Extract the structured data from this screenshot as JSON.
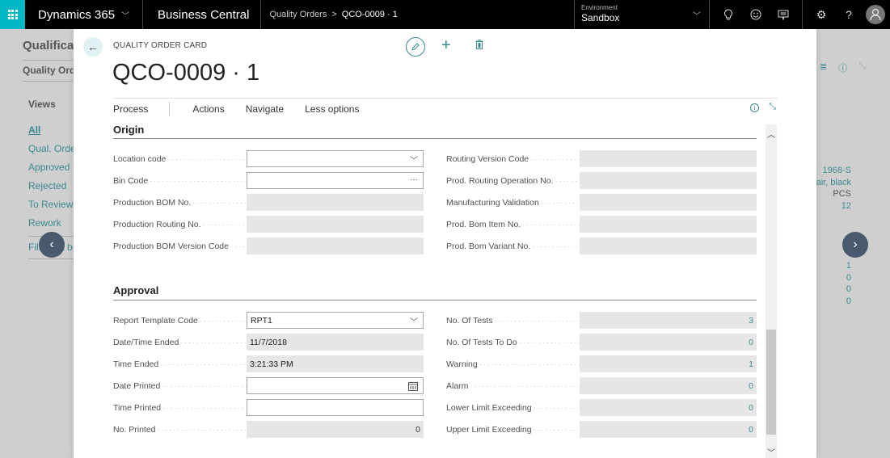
{
  "topbar": {
    "product": "Dynamics 365",
    "app": "Business Central",
    "breadcrumb_parent": "Quality Orders",
    "breadcrumb_sep": ">",
    "breadcrumb_current": "QCO-0009 · 1",
    "environment_label": "Environment",
    "environment_value": "Sandbox",
    "icons": [
      "lightbulb-icon",
      "smiley-icon",
      "feedback-icon",
      "gear-icon",
      "help-icon",
      "user-icon"
    ]
  },
  "background_page": {
    "title": "Qualificat",
    "subtitle": "Quality Orde",
    "views_label": "Views",
    "views": [
      "All",
      "Qual. Orde",
      "Approved",
      "Rejected",
      "To Review",
      "Rework",
      "Filter list b"
    ],
    "right_values": [
      "1968-S",
      "hair, black",
      "PCS",
      "12"
    ],
    "right_values_2": [
      "1",
      "0",
      "0",
      "0"
    ]
  },
  "card": {
    "label": "QUALITY ORDER CARD",
    "title": "QCO-0009 · 1",
    "actions": [
      "Process",
      "Actions",
      "Navigate",
      "Less options"
    ]
  },
  "origin": {
    "title": "Origin",
    "left": [
      {
        "label": "Location code",
        "value": "",
        "type": "dropdown"
      },
      {
        "label": "Bin Code",
        "value": "",
        "type": "lookup"
      },
      {
        "label": "Production BOM No.",
        "value": "",
        "type": "readonly"
      },
      {
        "label": "Production Routing No.",
        "value": "",
        "type": "readonly"
      },
      {
        "label": "Production BOM Version Code",
        "value": "",
        "type": "readonly"
      }
    ],
    "right": [
      {
        "label": "Routing Version Code",
        "value": ""
      },
      {
        "label": "Prod. Routing Operation No.",
        "value": ""
      },
      {
        "label": "Manufacturing Validation",
        "value": ""
      },
      {
        "label": "Prod. Bom Item No.",
        "value": ""
      },
      {
        "label": "Prod. Bom Variant No.",
        "value": ""
      }
    ]
  },
  "approval": {
    "title": "Approval",
    "left": [
      {
        "label": "Report Template Code",
        "value": "RPT1",
        "type": "dropdown"
      },
      {
        "label": "Date/Time Ended",
        "value": "11/7/2018",
        "type": "readonly"
      },
      {
        "label": "Time Ended",
        "value": "3:21:33 PM",
        "type": "readonly"
      },
      {
        "label": "Date Printed",
        "value": "",
        "type": "date"
      },
      {
        "label": "Time Printed",
        "value": "",
        "type": "text"
      },
      {
        "label": "No. Printed",
        "value": "0",
        "type": "readonly-number"
      }
    ],
    "right": [
      {
        "label": "No. Of Tests",
        "value": "3"
      },
      {
        "label": "No. Of Tests To Do",
        "value": "0"
      },
      {
        "label": "Warning",
        "value": "1"
      },
      {
        "label": "Alarm",
        "value": "0"
      },
      {
        "label": "Lower Limit Exceeding",
        "value": "0"
      },
      {
        "label": "Upper Limit Exceeding",
        "value": "0"
      }
    ]
  },
  "colors": {
    "accent": "#00b7c3",
    "link": "#3a8a8f",
    "topbar": "#000000",
    "readonly_field": "#e6e6e6"
  }
}
